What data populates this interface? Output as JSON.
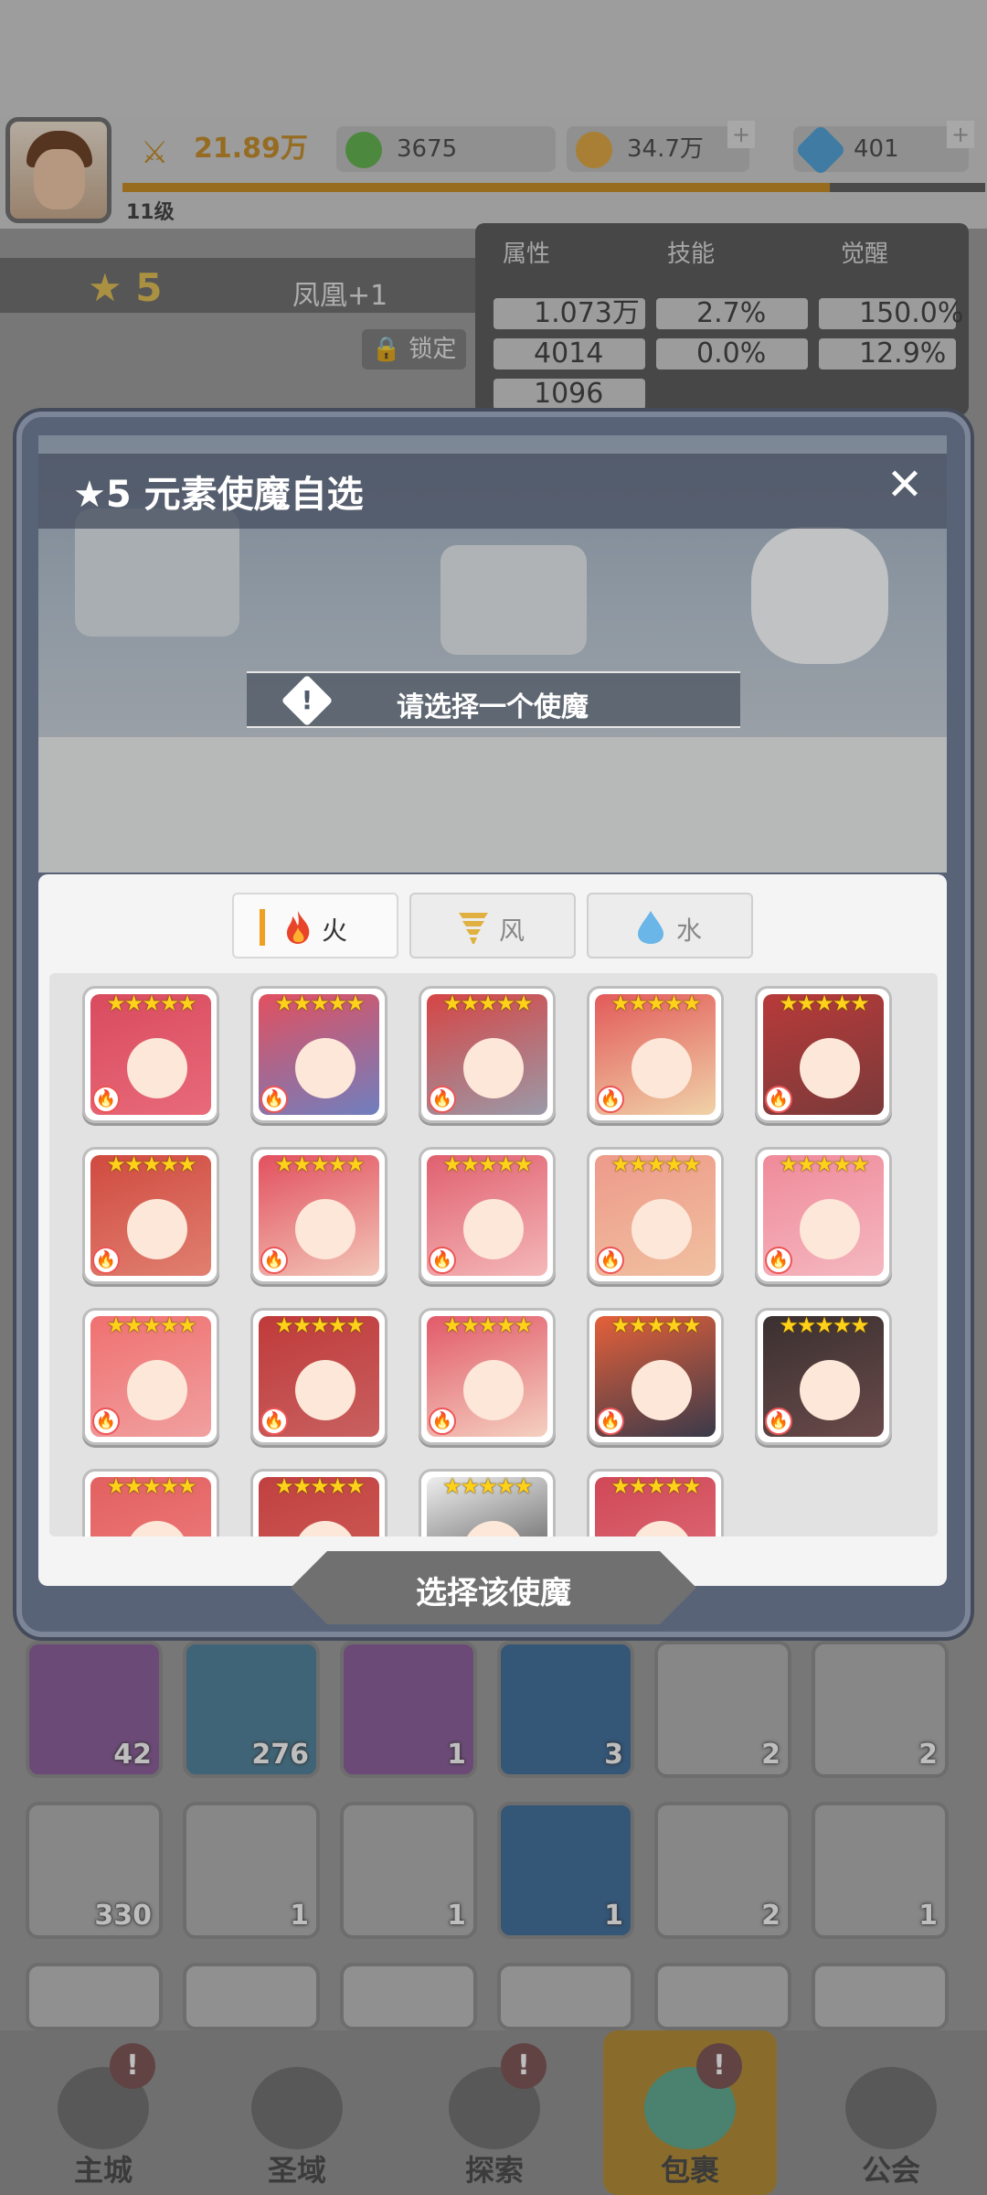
{
  "header": {
    "level": "11级",
    "power": "21.89万",
    "resources": [
      {
        "name": "green-gem",
        "value": "3675",
        "color": "#5db24a"
      },
      {
        "name": "gold-coin",
        "value": "34.7万",
        "color": "#e0a53a"
      },
      {
        "name": "blue-crystal",
        "value": "401",
        "color": "#4aa0d8"
      }
    ]
  },
  "hero": {
    "stars": "5",
    "name": "凤凰+1",
    "lock_label": "锁定",
    "tabs": [
      "属性",
      "技能",
      "觉醒"
    ],
    "stats": [
      [
        "1.073万",
        "2.7%",
        "150.0%"
      ],
      [
        "4014",
        "0.0%",
        "12.9%"
      ],
      [
        "1096",
        "",
        ""
      ]
    ]
  },
  "modal": {
    "title": "★5 元素使魔自选",
    "close_symbol": "✕",
    "notice_icon": "!",
    "notice": "请选择一个使魔",
    "tabs": [
      {
        "label": "火",
        "icon": "fire-icon",
        "active": true
      },
      {
        "label": "风",
        "icon": "tornado-icon",
        "active": false
      },
      {
        "label": "水",
        "icon": "water-drop-icon",
        "active": false
      }
    ],
    "card_stars": "★★★★★",
    "card_element": "🔥",
    "select_button": "选择该使魔"
  },
  "familiars": [
    {
      "color": "#e86a7a",
      "hair": "#d94b5e"
    },
    {
      "color": "#6f7fbf",
      "hair": "#e2505f"
    },
    {
      "color": "#9a9aa8",
      "hair": "#d64545"
    },
    {
      "color": "#f0d2a8",
      "hair": "#e25a5a"
    },
    {
      "color": "#7a3a3a",
      "hair": "#b83a3a"
    },
    {
      "color": "#e08070",
      "hair": "#d04a40"
    },
    {
      "color": "#f2c6b8",
      "hair": "#e2505f"
    },
    {
      "color": "#f4b8b8",
      "hair": "#e06070"
    },
    {
      "color": "#f0c0a0",
      "hair": "#ee9a8a"
    },
    {
      "color": "#f4b8c0",
      "hair": "#f08a9a"
    },
    {
      "color": "#f0a0a0",
      "hair": "#f07070"
    },
    {
      "color": "#c86060",
      "hair": "#c03a3a"
    },
    {
      "color": "#f4d0c0",
      "hair": "#e25a6a"
    },
    {
      "color": "#3a3a4a",
      "hair": "#e5603a"
    },
    {
      "color": "#6a4a4a",
      "hair": "#3a3030"
    },
    {
      "color": "#f08080",
      "hair": "#e26060"
    },
    {
      "color": "#d0605a",
      "hair": "#c04040"
    },
    {
      "color": "#404040",
      "hair": "#eeeeee"
    },
    {
      "color": "#e0707a",
      "hair": "#d04858"
    }
  ],
  "inventory": [
    {
      "count": "42",
      "color": "#8a5a9a"
    },
    {
      "count": "276",
      "color": "#4a7f9a"
    },
    {
      "count": "1",
      "color": "#8a5a9a"
    },
    {
      "count": "3",
      "color": "#3a6a9a"
    },
    {
      "count": "2",
      "color": "#b0b0b0"
    },
    {
      "count": "2",
      "color": "#b0b0b0"
    },
    {
      "count": "330",
      "color": "#b0b0b0"
    },
    {
      "count": "1",
      "color": "#b0b0b0"
    },
    {
      "count": "1",
      "color": "#b0b0b0"
    },
    {
      "count": "1",
      "color": "#3a6a9a"
    },
    {
      "count": "2",
      "color": "#b0b0b0"
    },
    {
      "count": "1",
      "color": "#b0b0b0"
    }
  ],
  "nav": [
    {
      "label": "主城",
      "badge": "!",
      "active": false
    },
    {
      "label": "圣域",
      "badge": "",
      "active": false
    },
    {
      "label": "探索",
      "badge": "!",
      "active": false
    },
    {
      "label": "包裹",
      "badge": "!",
      "active": true
    },
    {
      "label": "公会",
      "badge": "",
      "active": false
    }
  ]
}
